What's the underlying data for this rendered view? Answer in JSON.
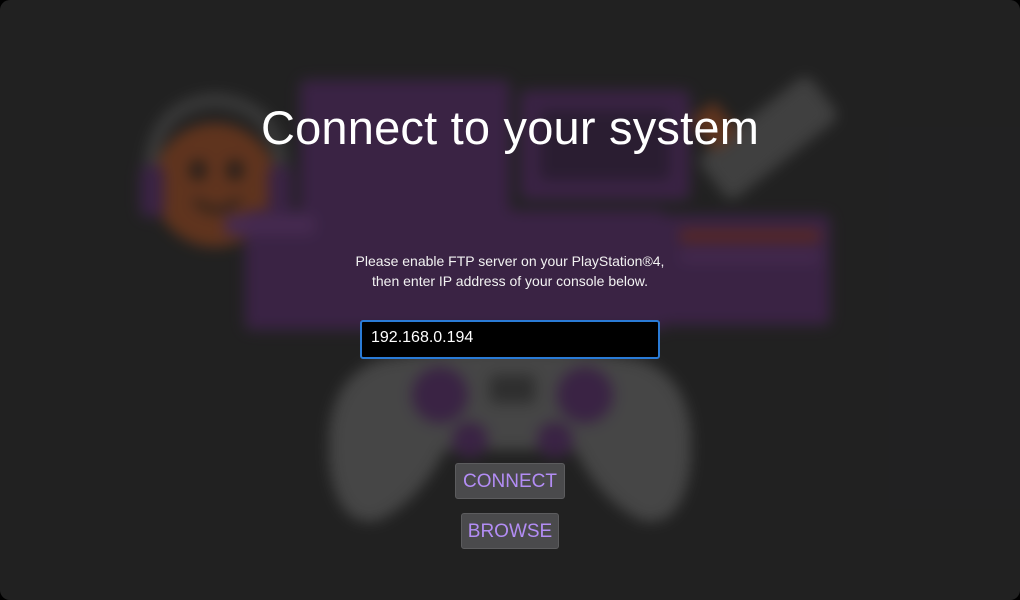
{
  "title": "Connect to your system",
  "instructions": {
    "line1": "Please enable FTP server on your PlayStation®4,",
    "line2": "then enter IP address of your console below."
  },
  "ip_field": {
    "value": "192.168.0.194"
  },
  "buttons": {
    "connect_label": "CONNECT",
    "browse_label": "BROWSE"
  },
  "colors": {
    "background": "#242424",
    "accent": "#b38df5",
    "input_border": "#2a7bd6",
    "art_purple": "#6a2a86",
    "art_orange": "#d2591c"
  }
}
